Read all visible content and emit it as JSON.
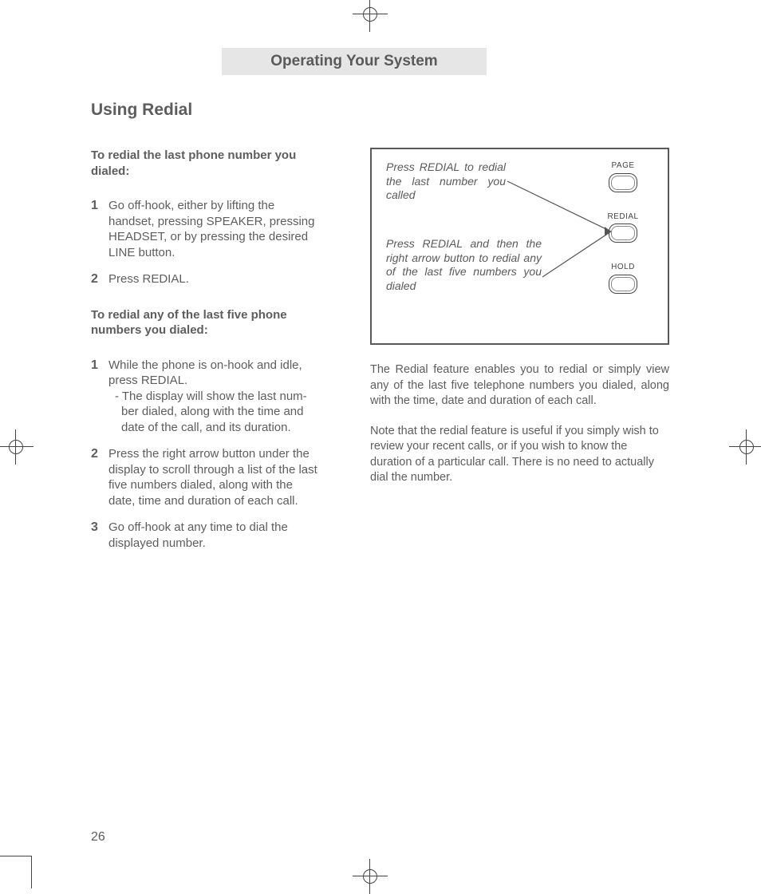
{
  "chapter_title": "Operating Your System",
  "section_title": "Using Redial",
  "left": {
    "sub1": "To redial the last phone num­ber you dialed:",
    "steps1": [
      "Go off-hook, either by lifting the handset, pressing SPEAKER, press­ing HEADSET, or by pressing the desired LINE button.",
      "Press REDIAL."
    ],
    "sub2": "To redial any of the last five phone numbers you dialed:",
    "steps2": [
      {
        "main": "While the phone is on-hook and idle, press REDIAL.",
        "sub": "- The display will show the last num­ber dialed, along with the time and date of the call, and its duration."
      },
      {
        "main": "Press the right arrow button under the display to scroll through a list of the last five numbers dialed, along with the date, time and duration of each call."
      },
      {
        "main": "Go off-hook at any time to dial the displayed number."
      }
    ]
  },
  "illustration": {
    "caption1": "Press REDIAL to redial the last num­ber you called",
    "caption2": "Press REDIAL and then the right arrow button to redial any of the last five numbers you dialed",
    "buttons": [
      "PAGE",
      "REDIAL",
      "HOLD"
    ]
  },
  "right_paras": [
    "The Redial feature enables you to redial or sim­ply view any of the last five telephone numbers you dialed, along with the time, date and dura­tion of each call.",
    "Note that the redial feature is useful if you sim­ply wish to review your recent calls, or if you wish to know the duration of a particular call. There is no need to actually dial the number."
  ],
  "page_number": "26"
}
